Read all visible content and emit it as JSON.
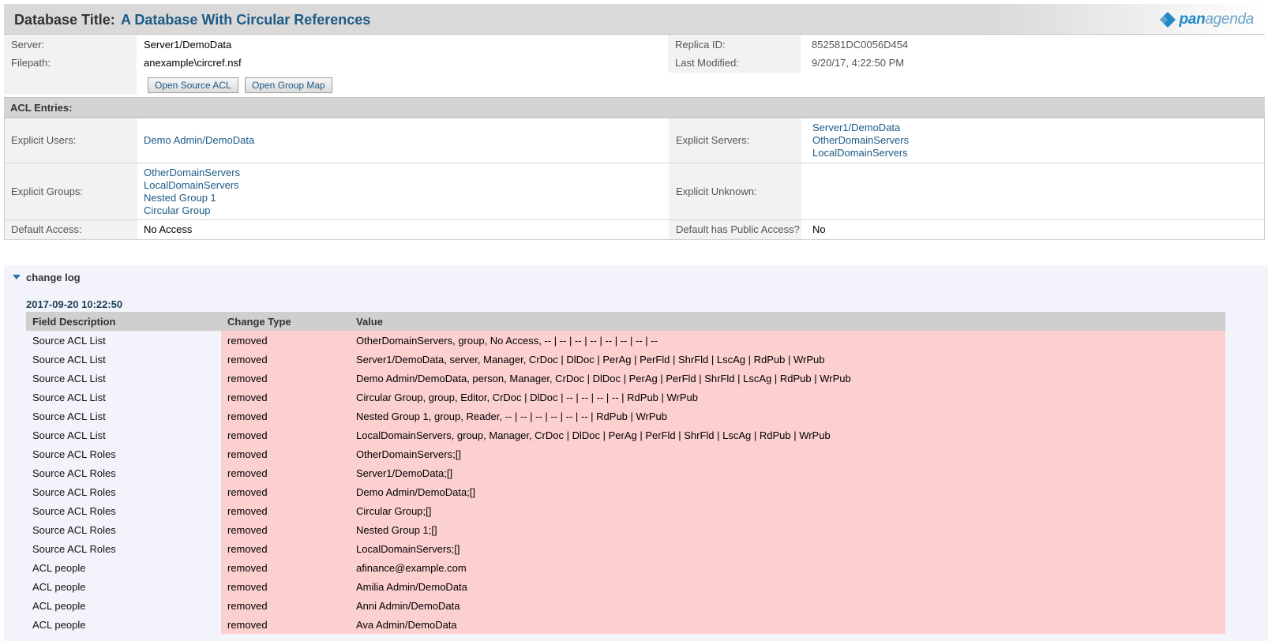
{
  "header": {
    "title_label": "Database Title:",
    "title_value": "A Database With Circular References",
    "logo_text_bold": "pan",
    "logo_text_light": "agenda"
  },
  "info": {
    "server_label": "Server:",
    "server_value": "Server1/DemoData",
    "filepath_label": "Filepath:",
    "filepath_value": "anexample\\circref.nsf",
    "replica_label": "Replica ID:",
    "replica_value": "852581DC0056D454",
    "modified_label": "Last Modified:",
    "modified_value": "9/20/17, 4:22:50 PM",
    "open_acl_button": "Open Source ACL",
    "open_group_map_button": "Open Group Map"
  },
  "acl": {
    "section_title": "ACL Entries:",
    "explicit_users_label": "Explicit Users:",
    "explicit_users": [
      "Demo Admin/DemoData"
    ],
    "explicit_servers_label": "Explicit Servers:",
    "explicit_servers": [
      "Server1/DemoData",
      "OtherDomainServers",
      "LocalDomainServers"
    ],
    "explicit_groups_label": "Explicit Groups:",
    "explicit_groups": [
      "OtherDomainServers",
      "LocalDomainServers",
      "Nested Group 1",
      "Circular Group"
    ],
    "explicit_unknown_label": "Explicit Unknown:",
    "default_access_label": "Default Access:",
    "default_access_value": "No Access",
    "default_public_label": "Default has Public Access?",
    "default_public_value": "No"
  },
  "changelog": {
    "title": "change log",
    "date": "2017-09-20 10:22:50",
    "columns": [
      "Field Description",
      "Change Type",
      "Value"
    ],
    "rows": [
      [
        "Source ACL List",
        "removed",
        "OtherDomainServers, group, No Access, -- | -- | -- | -- | -- | -- | -- | --"
      ],
      [
        "Source ACL List",
        "removed",
        "Server1/DemoData, server, Manager, CrDoc | DlDoc | PerAg | PerFld | ShrFld | LscAg | RdPub | WrPub"
      ],
      [
        "Source ACL List",
        "removed",
        "Demo Admin/DemoData, person, Manager, CrDoc | DlDoc | PerAg | PerFld | ShrFld | LscAg | RdPub | WrPub"
      ],
      [
        "Source ACL List",
        "removed",
        "Circular Group, group, Editor, CrDoc | DlDoc | -- | -- | -- | -- | RdPub | WrPub"
      ],
      [
        "Source ACL List",
        "removed",
        "Nested Group 1, group, Reader, -- | -- | -- | -- | -- | -- | RdPub | WrPub"
      ],
      [
        "Source ACL List",
        "removed",
        "LocalDomainServers, group, Manager, CrDoc | DlDoc | PerAg | PerFld | ShrFld | LscAg | RdPub | WrPub"
      ],
      [
        "Source ACL Roles",
        "removed",
        "OtherDomainServers;[]"
      ],
      [
        "Source ACL Roles",
        "removed",
        "Server1/DemoData;[]"
      ],
      [
        "Source ACL Roles",
        "removed",
        "Demo Admin/DemoData;[]"
      ],
      [
        "Source ACL Roles",
        "removed",
        "Circular Group;[]"
      ],
      [
        "Source ACL Roles",
        "removed",
        "Nested Group 1;[]"
      ],
      [
        "Source ACL Roles",
        "removed",
        "LocalDomainServers;[]"
      ],
      [
        "ACL people",
        "removed",
        "afinance@example.com"
      ],
      [
        "ACL people",
        "removed",
        "Amilia Admin/DemoData"
      ],
      [
        "ACL people",
        "removed",
        "Anni Admin/DemoData"
      ],
      [
        "ACL people",
        "removed",
        "Ava Admin/DemoData"
      ]
    ]
  }
}
